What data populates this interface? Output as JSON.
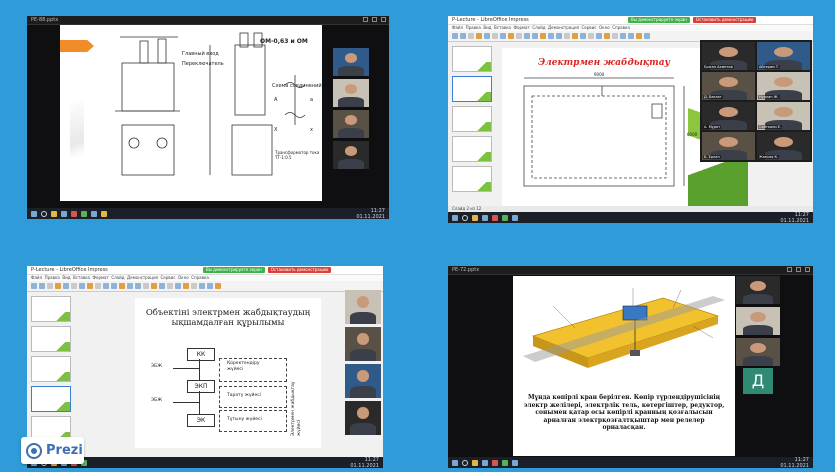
{
  "panels": {
    "p1": {
      "title": "РЕ-88.pptx",
      "slide": {
        "heading": "ОМ-0,63 и ОМ",
        "labels": [
          "Главный ввод",
          "Переключатель",
          "Схема соединений",
          "А",
          "Х",
          "а",
          "х"
        ],
        "notes": "Трансформатор тока\nТТ-1:0.5"
      },
      "taskbar_time": "11:27\n01.11.2021"
    },
    "p2": {
      "title": "Р-Lecture - LibreOffice Impress",
      "zoom_bar": {
        "sharing": "Вы демонстрируете экран",
        "stop": "Остановить демонстрацию"
      },
      "menu": [
        "Файл",
        "Правка",
        "Вид",
        "Вставка",
        "Формат",
        "Слайд",
        "Демонстрация",
        "Сервис",
        "Окно",
        "Справка"
      ],
      "slide": {
        "title": "Электрмен жабдықтау",
        "dimension_top": "9000",
        "dimension_side": "6000"
      },
      "participants": [
        "Ержан Ахметов",
        "Айгерим Т.",
        "Д. Бекзат",
        "Нурлан Ж.",
        "А. Мұрат",
        "Сейткали Е.",
        "Б. Ерлан",
        "Жансая К."
      ],
      "status": "Слайд 2 из 12",
      "taskbar_time": "11:27\n01.11.2021"
    },
    "p3": {
      "title": "Р-Lecture - LibreOffice Impress",
      "zoom_bar": {
        "sharing": "Вы демонстрируете экран",
        "stop": "Остановить демонстрацию"
      },
      "menu": [
        "Файл",
        "Правка",
        "Вид",
        "Вставка",
        "Формат",
        "Слайд",
        "Демонстрация",
        "Сервис",
        "Окно",
        "Справка"
      ],
      "slide": {
        "title": "Объектіні электрмен жабдықтаудың\nықшамдалған құрылымы",
        "boxes": {
          "kk": "КК",
          "ekp": "ЭКП",
          "ek": "ЭК"
        },
        "left_labels": {
          "ebzh1": "ЭБЖ",
          "ebzh2": "ЭБЖ"
        },
        "right_labels": {
          "r1": "Қоректендіру\nжүйесі",
          "r2": "Тарату жүйесі",
          "r3": "Тұтыну жүйесі"
        },
        "vertical": "Электрмен жабдықтау\nжүйесі"
      },
      "prezi": "Prezi",
      "taskbar_time": "11:27\n01.11.2021"
    },
    "p4": {
      "title": "РЕ-72.pptx",
      "slide": {
        "caption": "Мұнда көпірлі кран берілген. Көпір түрлендірушісінің электр желілері, электрлік тель, көтергіштер, редуктор, сонымен қатар осы көпірлі кранның қозғалысын арналған электрқозғалтқыштар мен релелер орналасқан."
      },
      "avatar_letter": "Д",
      "taskbar_time": "11:27\n01.11.2021"
    }
  },
  "colors": {
    "background": "#2f9bd8",
    "prezi_blue": "#3e6fb4",
    "zoom_green": "#3fb24a",
    "zoom_red": "#d8413b"
  }
}
